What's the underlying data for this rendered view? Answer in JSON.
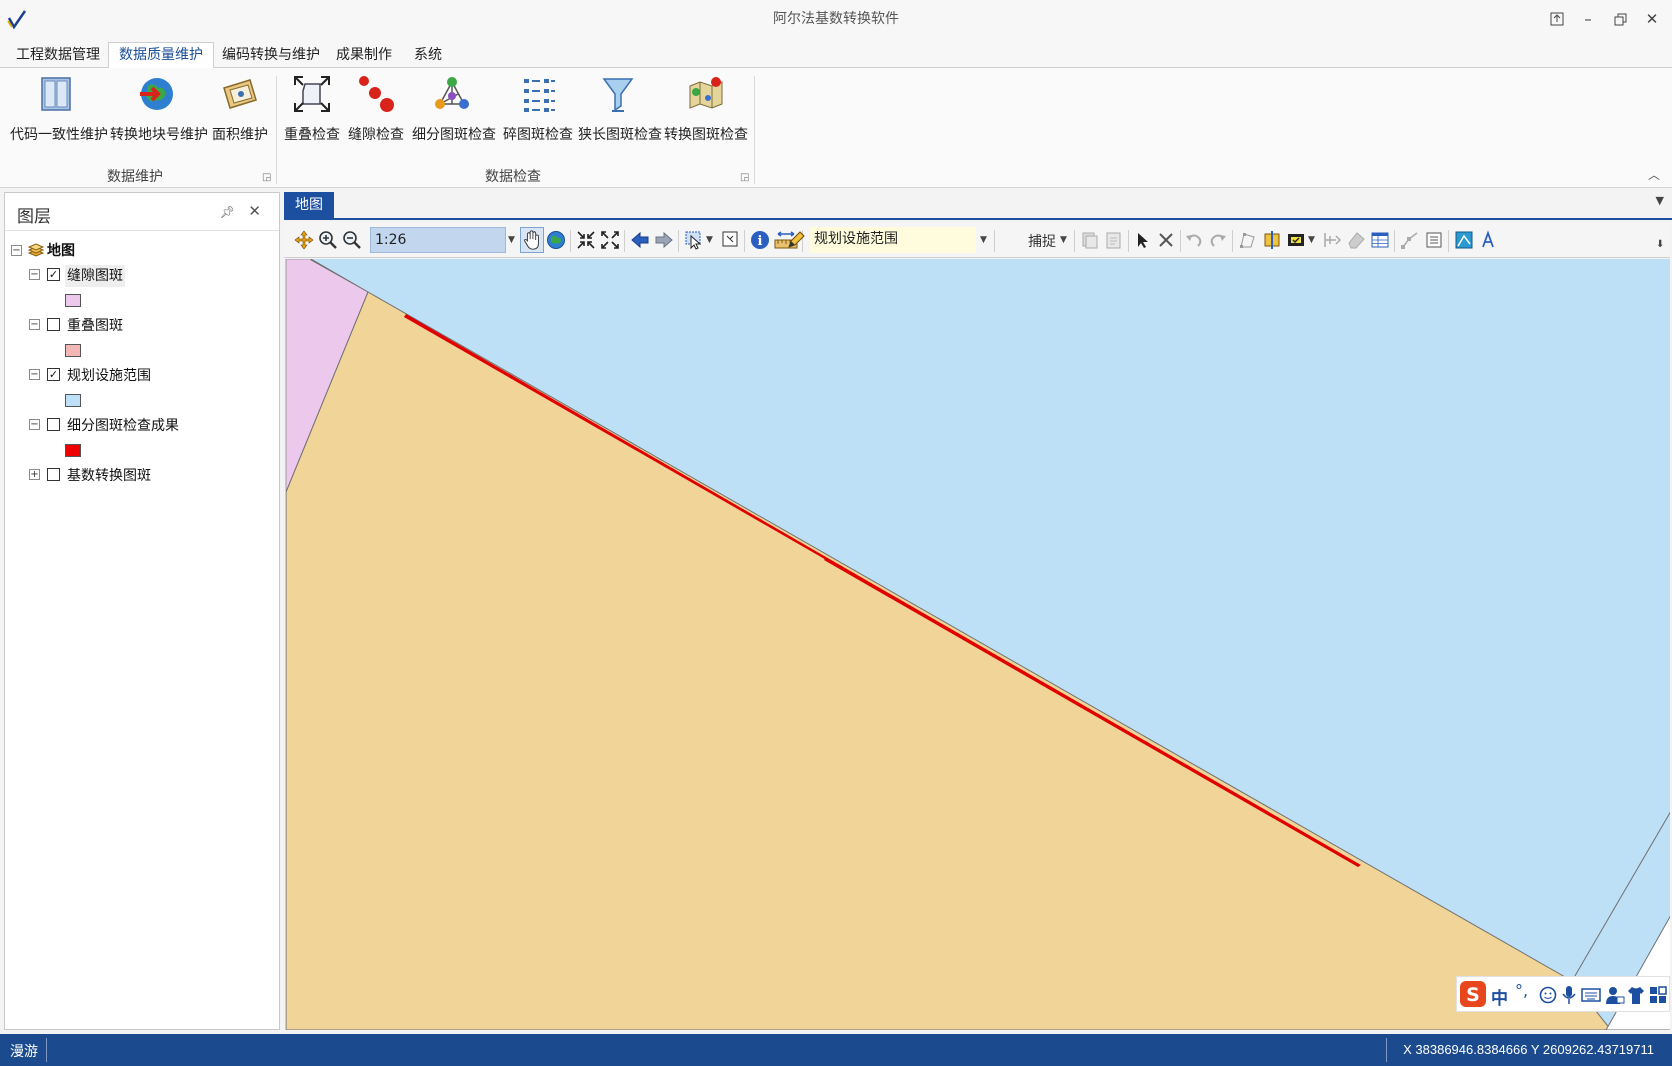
{
  "window": {
    "title": "阿尔法基数转换软件",
    "logo_icon": "app-logo-icon",
    "controls": [
      "restore-top-icon",
      "minimize-icon",
      "restore-icon",
      "close-icon"
    ]
  },
  "menu": {
    "tabs": [
      {
        "label": "工程数据管理"
      },
      {
        "label": "数据质量维护",
        "active": true
      },
      {
        "label": "编码转换与维护"
      },
      {
        "label": "成果制作"
      },
      {
        "label": "系统"
      }
    ]
  },
  "ribbon": {
    "groups": [
      {
        "label": "数据维护",
        "buttons": [
          {
            "label": "代码一致性维护",
            "icon": "book-icon"
          },
          {
            "label": "转换地块号维护",
            "icon": "globe-arrow-icon"
          },
          {
            "label": "面积维护",
            "icon": "area-map-icon"
          }
        ]
      },
      {
        "label": "数据检查",
        "buttons": [
          {
            "label": "重叠检查",
            "icon": "overlap-icon"
          },
          {
            "label": "缝隙检查",
            "icon": "gap-icon"
          },
          {
            "label": "细分图斑检查",
            "icon": "subdivide-icon"
          },
          {
            "label": "碎图斑检查",
            "icon": "fragment-icon"
          },
          {
            "label": "狭长图斑检查",
            "icon": "funnel-icon"
          },
          {
            "label": "转换图斑检查",
            "icon": "convert-map-icon"
          }
        ]
      }
    ]
  },
  "layer_panel": {
    "title": "图层",
    "root": {
      "label": "地图",
      "icon": "layers-icon"
    },
    "layers": [
      {
        "label": "缝隙图斑",
        "checked": true,
        "expanded": true,
        "swatch": "#ecc8ec"
      },
      {
        "label": "重叠图斑",
        "checked": false,
        "expanded": true,
        "swatch": "#f3b7b7"
      },
      {
        "label": "规划设施范围",
        "checked": true,
        "expanded": true,
        "swatch": "#bde0f6"
      },
      {
        "label": "细分图斑检查成果",
        "checked": false,
        "expanded": true,
        "swatch": "#ee0000"
      },
      {
        "label": "基数转换图斑",
        "checked": false,
        "expanded": false,
        "swatch": null
      }
    ]
  },
  "map": {
    "tab_label": "地图",
    "scale": "1:26",
    "target_layer": "规划设施范围",
    "snap_label": "捕捉",
    "colors": {
      "gap_polygon": "#ecc8ec",
      "planning_polygon": "#bde0f6",
      "conversion_polygon": "#f1d498",
      "sliver": "#e00000",
      "empty": "#ffffff"
    }
  },
  "ime": {
    "mode_char": "中",
    "punct": "°,"
  },
  "status": {
    "mode": "漫游",
    "coords": "X 38386946.8384666 Y 2609262.43719711"
  }
}
